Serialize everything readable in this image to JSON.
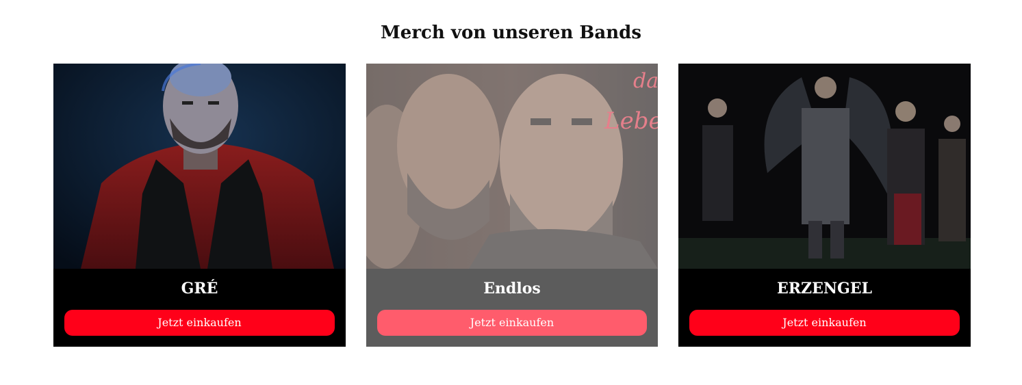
{
  "section": {
    "title": "Merch von unseren Bands"
  },
  "cards": [
    {
      "name": "GRÉ",
      "button_label": "Jetzt einkaufen",
      "image": "band-photo-gre"
    },
    {
      "name": "Endlos",
      "button_label": "Jetzt einkaufen",
      "image": "band-photo-endlos",
      "dimmed": true
    },
    {
      "name": "ERZENGEL",
      "button_label": "Jetzt einkaufen",
      "image": "band-photo-erzengel"
    }
  ],
  "colors": {
    "card_background": "#000000",
    "button": "#ff0019",
    "title": "#111111"
  }
}
